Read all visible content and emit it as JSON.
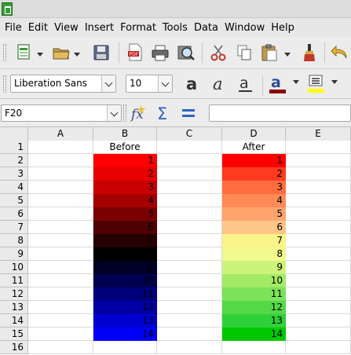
{
  "menu": [
    "File",
    "Edit",
    "View",
    "Insert",
    "Format",
    "Tools",
    "Data",
    "Window",
    "Help"
  ],
  "font": {
    "name": "Liberation Sans",
    "size": "10"
  },
  "formula": {
    "cell_ref": "F20",
    "content": ""
  },
  "columns": [
    "A",
    "B",
    "C",
    "D",
    "E"
  ],
  "rows": [
    "1",
    "2",
    "3",
    "4",
    "5",
    "6",
    "7",
    "8",
    "9",
    "10",
    "11",
    "12",
    "13",
    "14",
    "15",
    "16"
  ],
  "headers": {
    "before": "Before",
    "after": "After"
  },
  "before_values": [
    "1",
    "2",
    "3",
    "4",
    "5",
    "6",
    "7",
    "8",
    "9",
    "10",
    "11",
    "12",
    "13",
    "14"
  ],
  "after_values": [
    "1",
    "2",
    "3",
    "4",
    "5",
    "6",
    "7",
    "8",
    "9",
    "10",
    "11",
    "12",
    "13",
    "14"
  ],
  "before_colors": [
    "#ff0000",
    "#e80000",
    "#c90000",
    "#a40000",
    "#7b0000",
    "#4f0000",
    "#250000",
    "#000000",
    "#000026",
    "#000050",
    "#00007a",
    "#0000a5",
    "#0000d0",
    "#0000f8"
  ],
  "after_colors": [
    "#ff0000",
    "#ff3b1f",
    "#ff6d3f",
    "#ff8a55",
    "#ffa46d",
    "#ffc687",
    "#f9f487",
    "#f2f98d",
    "#ccf37a",
    "#a2eb66",
    "#7ce25a",
    "#54d848",
    "#2fd13b",
    "#00c800"
  ],
  "colors": {
    "menubar_bg": "#e7e7e7",
    "toolbar_bg": "#ececec",
    "header_bg": "#eaeaea",
    "font_color_bar": "#8b0000",
    "highlight_bar": "#ffff00"
  }
}
